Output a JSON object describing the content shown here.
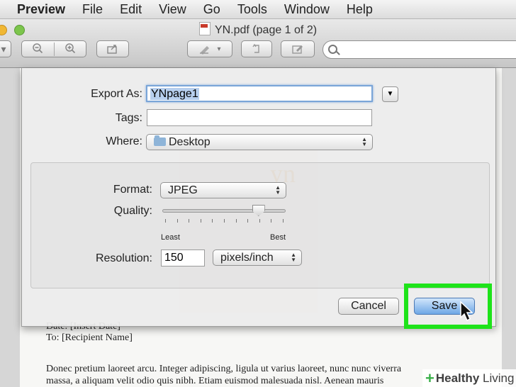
{
  "menubar": {
    "app": "Preview",
    "items": [
      "File",
      "Edit",
      "View",
      "Go",
      "Tools",
      "Window",
      "Help"
    ]
  },
  "window": {
    "title": "YN.pdf (page 1 of 2)"
  },
  "dialog": {
    "export_as_label": "Export As:",
    "export_as_value": "YNpage1",
    "tags_label": "Tags:",
    "tags_value": "",
    "where_label": "Where:",
    "where_value": "Desktop",
    "format_label": "Format:",
    "format_value": "JPEG",
    "quality_label": "Quality:",
    "quality_level": 0.78,
    "quality_min_label": "Least",
    "quality_max_label": "Best",
    "resolution_label": "Resolution:",
    "resolution_value": "150",
    "resolution_unit": "pixels/inch",
    "cancel_label": "Cancel",
    "save_label": "Save"
  },
  "document": {
    "line1": "Date: [Insert Date]",
    "line2": "To: [Recipient Name]",
    "para1": "Donec pretium laoreet arcu. Integer adipiscing, ligula ut varius laoreet, nunc nunc viverra",
    "para2": "massa, a aliquam velit odio quis nibh. Etiam euismod malesuada nisl. Aenean mauris",
    "watermark_text": "yn"
  },
  "branding": {
    "first": "Healthy",
    "second": "Living"
  },
  "colors": {
    "highlight": "#1ee31a",
    "default_button": "#6ea7e6"
  }
}
